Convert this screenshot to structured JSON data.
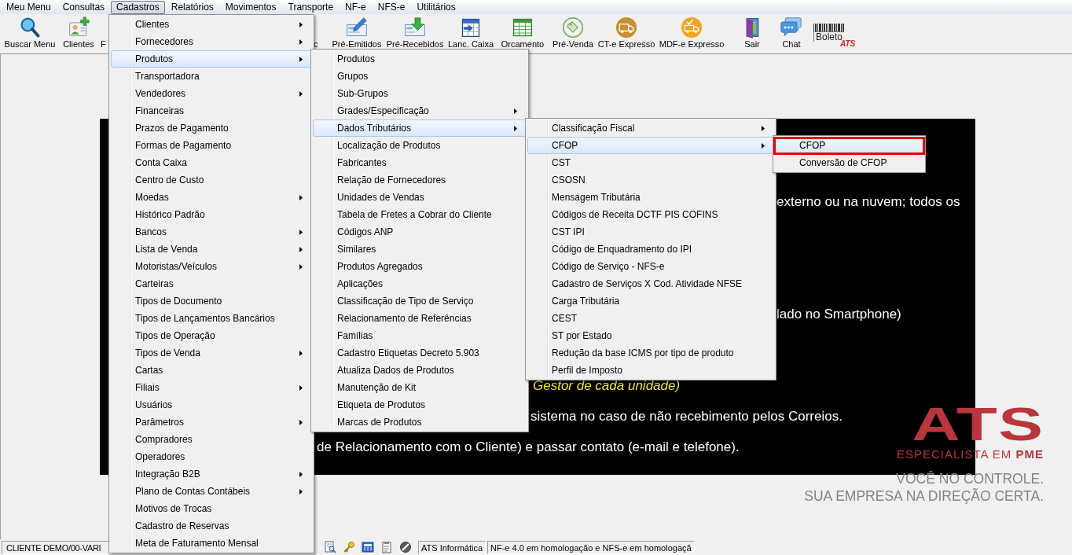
{
  "menu_bar": {
    "items": [
      {
        "label": "Meu Menu",
        "selected": false
      },
      {
        "label": "Consultas",
        "selected": false
      },
      {
        "label": "Cadastros",
        "selected": true
      },
      {
        "label": "Relatórios",
        "selected": false
      },
      {
        "label": "Movimentos",
        "selected": false
      },
      {
        "label": "Transporte",
        "selected": false
      },
      {
        "label": "NF-e",
        "selected": false
      },
      {
        "label": "NFS-e",
        "selected": false
      },
      {
        "label": "Utilitários",
        "selected": false
      }
    ]
  },
  "toolbar": {
    "items": [
      {
        "label": "Buscar Menu"
      },
      {
        "label": "Clientes"
      },
      {
        "label": "F"
      },
      {
        "label": "c"
      },
      {
        "label": "Pré-Emitidos"
      },
      {
        "label": "Pré-Recebidos"
      },
      {
        "label": "Lanc. Caixa"
      },
      {
        "label": "Orcamento"
      },
      {
        "label": "Pré-Venda"
      },
      {
        "label": "CT-e Expresso"
      },
      {
        "label": "MDF-e Expresso"
      },
      {
        "label": "Sair"
      },
      {
        "label": "Chat"
      }
    ],
    "boleto_logo": {
      "text": "Boleto",
      "brand": "ATS"
    }
  },
  "content_panel": {
    "lines": [
      {
        "text": "externo ou na nuvem; todos os",
        "kind": "normal"
      },
      {
        "text": "lado no Smartphone)",
        "kind": "normal"
      },
      {
        "text": "Gestor de cada unidade)",
        "kind": "emphasis"
      },
      {
        "text": "sistema no caso de não recebimento pelos Correios.",
        "kind": "normal"
      },
      {
        "text": "de Relacionamento com o Cliente) e passar contato (e-mail e telefone).",
        "kind": "normal"
      }
    ]
  },
  "brand_logo": {
    "mark": "ATS",
    "tagline": "ESPECIALISTA EM **PME**",
    "slogan": [
      "VOCÊ NO CONTROLE.",
      "SUA EMPRESA NA DIREÇÃO CERTA."
    ]
  },
  "open_menus": [
    {
      "items": [
        {
          "label": "Clientes",
          "has_submenu": true,
          "selected": false
        },
        {
          "label": "Fornecedores",
          "has_submenu": true,
          "selected": false
        },
        {
          "label": "Produtos",
          "has_submenu": true,
          "selected": true
        },
        {
          "label": "Transportadora",
          "has_submenu": false,
          "selected": false
        },
        {
          "label": "Vendedores",
          "has_submenu": true,
          "selected": false
        },
        {
          "label": "Financeiras",
          "has_submenu": false,
          "selected": false
        },
        {
          "label": "Prazos de Pagamento",
          "has_submenu": false,
          "selected": false
        },
        {
          "label": "Formas de Pagamento",
          "has_submenu": false,
          "selected": false
        },
        {
          "label": "Conta Caixa",
          "has_submenu": false,
          "selected": false
        },
        {
          "label": "Centro de Custo",
          "has_submenu": false,
          "selected": false
        },
        {
          "label": "Moedas",
          "has_submenu": true,
          "selected": false
        },
        {
          "label": "Histórico Padrão",
          "has_submenu": false,
          "selected": false
        },
        {
          "label": "Bancos",
          "has_submenu": true,
          "selected": false
        },
        {
          "label": "Lista de Venda",
          "has_submenu": true,
          "selected": false
        },
        {
          "label": "Motoristas/Veículos",
          "has_submenu": true,
          "selected": false
        },
        {
          "label": "Carteiras",
          "has_submenu": false,
          "selected": false
        },
        {
          "label": "Tipos de Documento",
          "has_submenu": false,
          "selected": false
        },
        {
          "label": "Tipos de Lançamentos Bancários",
          "has_submenu": false,
          "selected": false
        },
        {
          "label": "Tipos de Operação",
          "has_submenu": false,
          "selected": false
        },
        {
          "label": "Tipos de Venda",
          "has_submenu": true,
          "selected": false
        },
        {
          "label": "Cartas",
          "has_submenu": false,
          "selected": false
        },
        {
          "label": "Filiais",
          "has_submenu": true,
          "selected": false
        },
        {
          "label": "Usuários",
          "has_submenu": false,
          "selected": false
        },
        {
          "label": "Parâmetros",
          "has_submenu": true,
          "selected": false
        },
        {
          "label": "Compradores",
          "has_submenu": false,
          "selected": false
        },
        {
          "label": "Operadores",
          "has_submenu": false,
          "selected": false
        },
        {
          "label": "Integração B2B",
          "has_submenu": true,
          "selected": false
        },
        {
          "label": "Plano de Contas Contábeis",
          "has_submenu": true,
          "selected": false
        },
        {
          "label": "Motivos de Trocas",
          "has_submenu": false,
          "selected": false
        },
        {
          "label": "Cadastro de Reservas",
          "has_submenu": false,
          "selected": false
        },
        {
          "label": "Meta de Faturamento Mensal",
          "has_submenu": false,
          "selected": false
        }
      ]
    },
    {
      "items": [
        {
          "label": "Produtos",
          "has_submenu": false,
          "selected": false
        },
        {
          "label": "Grupos",
          "has_submenu": false,
          "selected": false
        },
        {
          "label": "Sub-Grupos",
          "has_submenu": false,
          "selected": false
        },
        {
          "label": "Grades/Especificação",
          "has_submenu": true,
          "selected": false
        },
        {
          "label": "Dados Tributários",
          "has_submenu": true,
          "selected": true
        },
        {
          "label": "Localização de Produtos",
          "has_submenu": false,
          "selected": false
        },
        {
          "label": "Fabricantes",
          "has_submenu": false,
          "selected": false
        },
        {
          "label": "Relação de Fornecedores",
          "has_submenu": false,
          "selected": false
        },
        {
          "label": "Unidades de Vendas",
          "has_submenu": false,
          "selected": false
        },
        {
          "label": "Tabela de Fretes a Cobrar do Cliente",
          "has_submenu": false,
          "selected": false
        },
        {
          "label": "Códigos ANP",
          "has_submenu": false,
          "selected": false
        },
        {
          "label": "Similares",
          "has_submenu": false,
          "selected": false
        },
        {
          "label": "Produtos Agregados",
          "has_submenu": false,
          "selected": false
        },
        {
          "label": "Aplicações",
          "has_submenu": false,
          "selected": false
        },
        {
          "label": "Classificação de Tipo de Serviço",
          "has_submenu": false,
          "selected": false
        },
        {
          "label": "Relacionamento de Referências",
          "has_submenu": false,
          "selected": false
        },
        {
          "label": "Famílias",
          "has_submenu": false,
          "selected": false
        },
        {
          "label": "Cadastro Etiquetas Decreto 5.903",
          "has_submenu": false,
          "selected": false
        },
        {
          "label": "Atualiza Dados de Produtos",
          "has_submenu": false,
          "selected": false
        },
        {
          "label": "Manutenção de Kit",
          "has_submenu": false,
          "selected": false
        },
        {
          "label": "Etiqueta de Produtos",
          "has_submenu": false,
          "selected": false
        },
        {
          "label": "Marcas de Produtos",
          "has_submenu": false,
          "selected": false
        }
      ]
    },
    {
      "items": [
        {
          "label": "Classificação Fiscal",
          "has_submenu": true,
          "selected": false
        },
        {
          "label": "CFOP",
          "has_submenu": true,
          "selected": true
        },
        {
          "label": "CST",
          "has_submenu": false,
          "selected": false
        },
        {
          "label": "CSOSN",
          "has_submenu": false,
          "selected": false
        },
        {
          "label": "Mensagem Tributária",
          "has_submenu": false,
          "selected": false
        },
        {
          "label": "Códigos de Receita DCTF PIS COFINS",
          "has_submenu": false,
          "selected": false
        },
        {
          "label": "CST IPI",
          "has_submenu": false,
          "selected": false
        },
        {
          "label": "Código de Enquadramento do IPI",
          "has_submenu": false,
          "selected": false
        },
        {
          "label": "Código de Serviço - NFS-e",
          "has_submenu": false,
          "selected": false
        },
        {
          "label": "Cadastro de Serviços X Cod. Atividade NFSE",
          "has_submenu": false,
          "selected": false
        },
        {
          "label": "Carga Tributária",
          "has_submenu": false,
          "selected": false
        },
        {
          "label": "CEST",
          "has_submenu": false,
          "selected": false
        },
        {
          "label": "ST por Estado",
          "has_submenu": false,
          "selected": false
        },
        {
          "label": "Redução da base ICMS por tipo de produto",
          "has_submenu": false,
          "selected": false
        },
        {
          "label": "Perfil de Imposto",
          "has_submenu": false,
          "selected": false
        }
      ]
    },
    {
      "items": [
        {
          "label": "CFOP",
          "has_submenu": false,
          "selected": true,
          "annotated": true
        },
        {
          "label": "Conversão de CFOP",
          "has_submenu": false,
          "selected": false,
          "annotated": false
        }
      ]
    }
  ],
  "status_bar": {
    "client": "CLIENTE DEMO/00-VARI",
    "company": "ATS Informática",
    "message": "NF-e 4.0 em homologação e NFS-e em homologaçã"
  }
}
